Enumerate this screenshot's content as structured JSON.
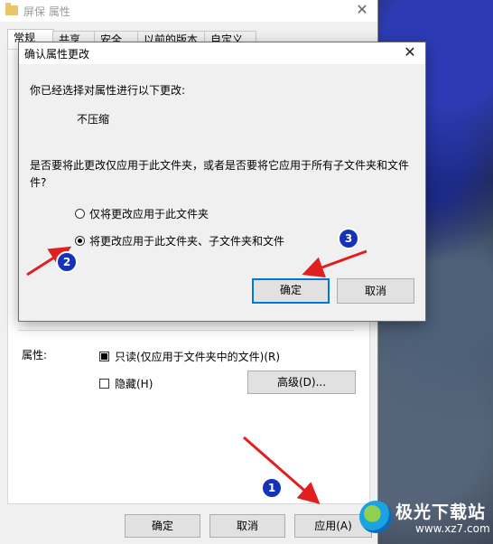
{
  "props_window": {
    "title": "屏保 属性",
    "tabs": [
      "常规",
      "共享",
      "安全",
      "以前的版本",
      "自定义"
    ],
    "attributes_label": "属性:",
    "readonly_label": "只读(仅应用于文件夹中的文件)(R)",
    "hidden_label": "隐藏(H)",
    "advanced_button": "高级(D)...",
    "ok_button": "确定",
    "cancel_button": "取消",
    "apply_button": "应用(A)"
  },
  "dialog": {
    "title": "确认属性更改",
    "intro": "你已经选择对属性进行以下更改:",
    "change": "不压缩",
    "question_line1": "是否要将此更改仅应用于此文件夹，或者是否要将它应用于所有子文件夹和文件",
    "question_line2": "件?",
    "option_folder_only": "仅将更改应用于此文件夹",
    "option_all": "将更改应用于此文件夹、子文件夹和文件",
    "ok_button": "确定",
    "cancel_button": "取消"
  },
  "badges": [
    "1",
    "2",
    "3"
  ],
  "watermark": {
    "name": "极光下载站",
    "url": "www.xz7.com"
  },
  "colors": {
    "accent": "#0078d7",
    "badge": "#1533b8",
    "arrow": "#e02020"
  }
}
